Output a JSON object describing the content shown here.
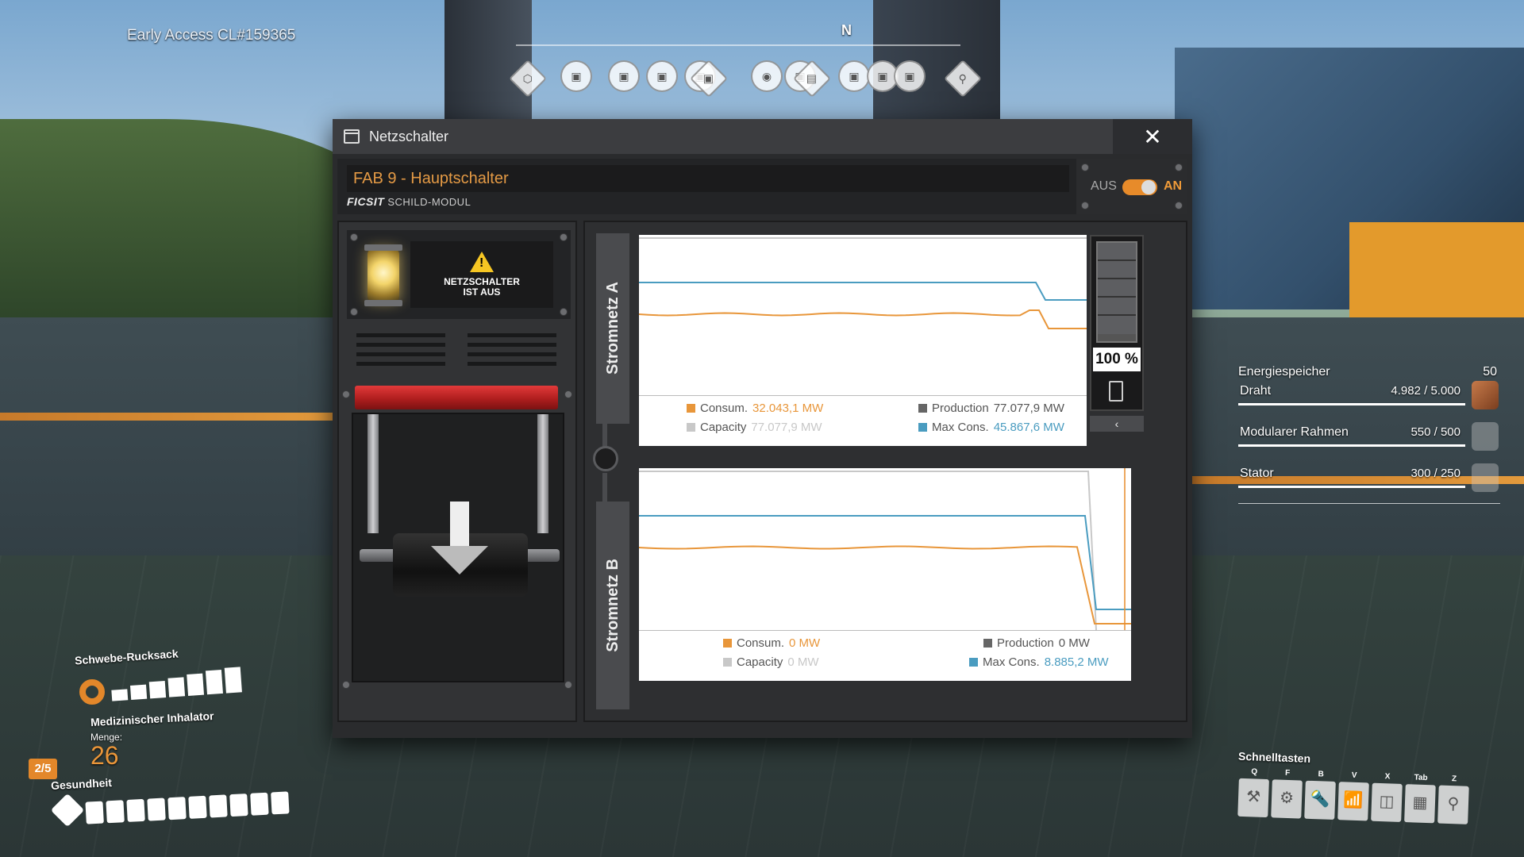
{
  "hud": {
    "build_tag": "Early Access CL#159365",
    "compass_dir": "N"
  },
  "window": {
    "title": "Netzschalter",
    "close_glyph": "✕",
    "switch_name": "FAB 9 - Hauptschalter",
    "ficsit_logo": "FICSIT",
    "ficsit_module": "SCHILD-MODUL",
    "toggle_off": "AUS",
    "toggle_on": "AN",
    "status_line1": "NETZSCHALTER",
    "status_line2": "IST AUS"
  },
  "grid_a": {
    "label": "Stromnetz A",
    "consum_label": "Consum.",
    "consum_value": "32.043,1 MW",
    "production_label": "Production",
    "production_value": "77.077,9 MW",
    "capacity_label": "Capacity",
    "capacity_value": "77.077,9 MW",
    "maxcons_label": "Max Cons.",
    "maxcons_value": "45.867,6 MW",
    "battery_pct": "100 %",
    "battery_level": 1.0
  },
  "grid_b": {
    "label": "Stromnetz B",
    "consum_label": "Consum.",
    "consum_value": "0 MW",
    "production_label": "Production",
    "production_value": "0 MW",
    "capacity_label": "Capacity",
    "capacity_value": "0 MW",
    "maxcons_label": "Max Cons.",
    "maxcons_value": "8.885,2 MW"
  },
  "colors": {
    "consumption": "#e8963a",
    "production": "#666666",
    "capacity": "#c8c8c8",
    "max_cons": "#4a9cc0",
    "accent": "#e78b2a"
  },
  "resources": {
    "title": "Energiespeicher",
    "title_count": "50",
    "items": [
      {
        "label": "Draht",
        "value": "4.982 / 5.000"
      },
      {
        "label": "Modularer Rahmen",
        "value": "550 / 500"
      },
      {
        "label": "Stator",
        "value": "300 / 250"
      }
    ]
  },
  "quickslots": {
    "title": "Schnelltasten",
    "keys": [
      "Q",
      "F",
      "B",
      "V",
      "X",
      "Tab",
      "Z"
    ]
  },
  "equipment": {
    "jetpack_label": "Schwebe-Rucksack",
    "inhaler_label": "Medizinischer Inhalator",
    "menge_label": "Menge:",
    "menge_value": "26",
    "slot_fraction": "2/5",
    "health_label": "Gesundheit"
  }
}
